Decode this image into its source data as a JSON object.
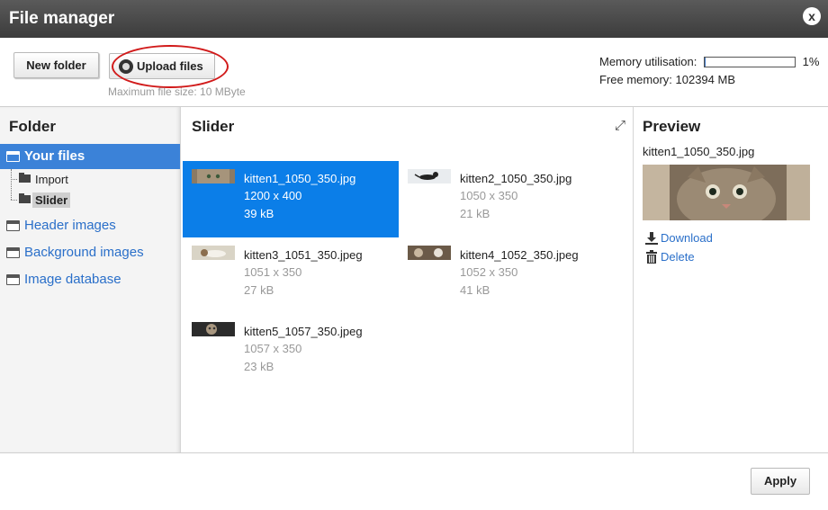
{
  "window": {
    "title": "File manager",
    "close_symbol": "x"
  },
  "toolbar": {
    "new_folder_label": "New folder",
    "upload_label": "Upload files",
    "max_file_size": "Maximum file size: 10 MByte",
    "memory_label": "Memory utilisation:",
    "memory_percent_text": "1%",
    "memory_fraction": 0.01,
    "free_memory": "Free memory: 102394 MB"
  },
  "folder_pane": {
    "heading": "Folder",
    "root": "Your files",
    "subfolders": [
      "Import",
      "Slider"
    ],
    "others": [
      "Header images",
      "Background images",
      "Image database"
    ]
  },
  "center": {
    "heading": "Slider",
    "files": [
      {
        "name": "kitten1_1050_350.jpg",
        "dims": "1200 x 400",
        "size": "39 kB",
        "selected": true
      },
      {
        "name": "kitten2_1050_350.jpg",
        "dims": "1050 x 350",
        "size": "21 kB"
      },
      {
        "name": "kitten3_1051_350.jpeg",
        "dims": "1051 x 350",
        "size": "27 kB"
      },
      {
        "name": "kitten4_1052_350.jpeg",
        "dims": "1052 x 350",
        "size": "41 kB"
      },
      {
        "name": "kitten5_1057_350.jpeg",
        "dims": "1057 x 350",
        "size": "23 kB"
      }
    ]
  },
  "preview": {
    "heading": "Preview",
    "filename": "kitten1_1050_350.jpg",
    "download_label": "Download",
    "delete_label": "Delete"
  },
  "footer": {
    "apply_label": "Apply"
  },
  "colors": {
    "selection": "#0b7ee8",
    "link": "#2a6fc9",
    "titlebar": "#4a4a4a",
    "highlight_ring": "#d11a1a"
  }
}
